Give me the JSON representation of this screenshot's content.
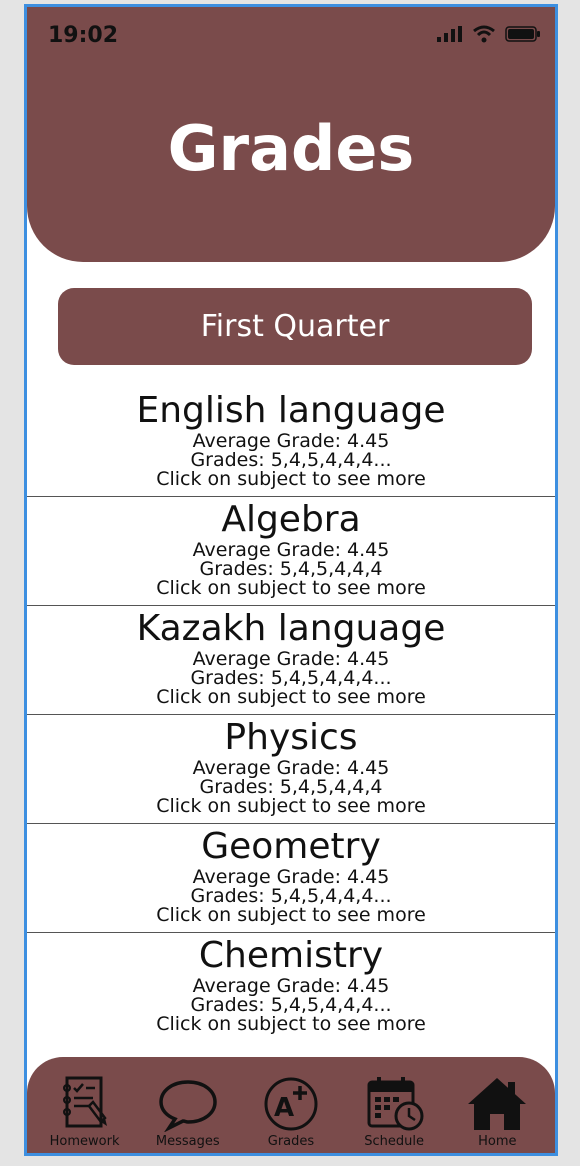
{
  "status_bar": {
    "time": "19:02"
  },
  "header": {
    "title": "Grades"
  },
  "quarter_button": {
    "label": "First Quarter"
  },
  "subjects": [
    {
      "name": "English language",
      "average": "Average Grade: 4.45",
      "grades": "Grades: 5,4,5,4,4,4...",
      "hint": "Click on subject to see more"
    },
    {
      "name": "Algebra",
      "average": "Average Grade: 4.45",
      "grades": "Grades: 5,4,5,4,4,4",
      "hint": "Click on subject to see more"
    },
    {
      "name": "Kazakh language",
      "average": "Average Grade: 4.45",
      "grades": "Grades: 5,4,5,4,4,4...",
      "hint": "Click on subject to see more"
    },
    {
      "name": "Physics",
      "average": "Average Grade: 4.45",
      "grades": "Grades: 5,4,5,4,4,4",
      "hint": "Click on subject to see more"
    },
    {
      "name": "Geometry",
      "average": "Average Grade: 4.45",
      "grades": "Grades: 5,4,5,4,4,4...",
      "hint": "Click on subject to see more"
    },
    {
      "name": "Chemistry",
      "average": "Average Grade: 4.45",
      "grades": "Grades: 5,4,5,4,4,4...",
      "hint": "Click on subject to see more"
    }
  ],
  "bottom_nav": [
    {
      "label": "Homework",
      "icon": "homework-icon"
    },
    {
      "label": "Messages",
      "icon": "speech-bubble-icon"
    },
    {
      "label": "Grades",
      "icon": "a-plus-icon"
    },
    {
      "label": "Schedule",
      "icon": "calendar-clock-icon"
    },
    {
      "label": "Home",
      "icon": "house-icon"
    }
  ],
  "colors": {
    "header": "#7a4b4b",
    "frame": "#3d8fe0",
    "text": "#111111"
  }
}
